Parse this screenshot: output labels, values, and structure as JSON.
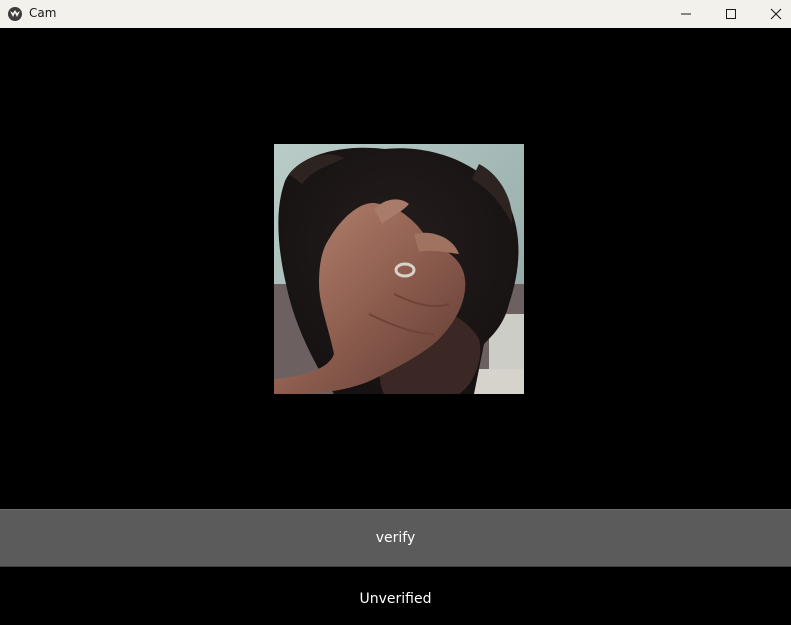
{
  "window": {
    "title": "Cam",
    "icon": "kivy-app-icon",
    "controls": [
      "minimize-icon",
      "maximize-icon",
      "close-icon"
    ]
  },
  "camera": {
    "icon": "camera-feed-image"
  },
  "verify_button": {
    "label": "verify"
  },
  "status": {
    "label": "Unverified"
  }
}
